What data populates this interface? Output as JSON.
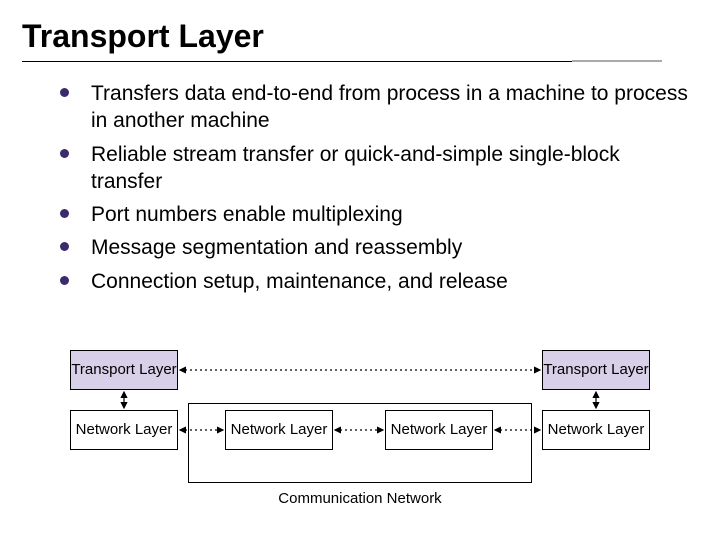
{
  "title": "Transport Layer",
  "bullets": [
    "Transfers data end-to-end from process in a machine to process in another machine",
    "Reliable stream transfer or quick-and-simple single-block transfer",
    "Port numbers enable multiplexing",
    "Message segmentation and reassembly",
    "Connection setup, maintenance, and release"
  ],
  "diagram": {
    "transport_label": "Transport Layer",
    "network_label": "Network Layer",
    "communication_label": "Communication Network"
  }
}
